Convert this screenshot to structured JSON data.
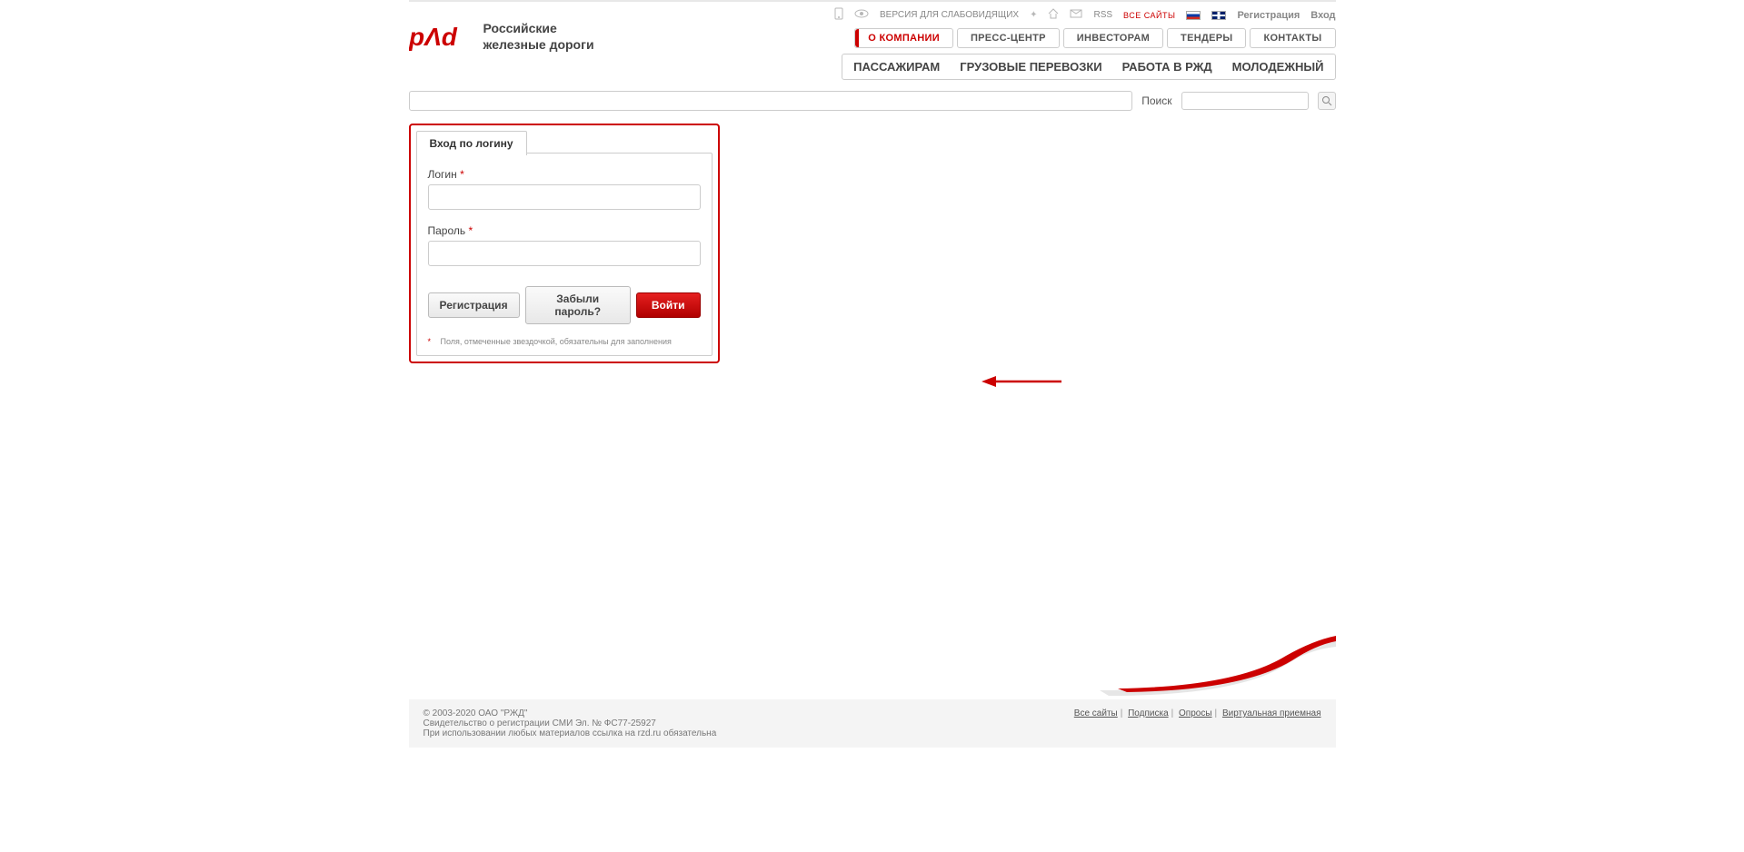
{
  "logo": {
    "line1": "Российские",
    "line2": "железные дороги",
    "mark": "РЖД"
  },
  "top": {
    "visually_impaired": "ВЕРСИЯ ДЛЯ СЛАБОВИДЯЩИХ",
    "rss": "RSS",
    "all_sites": "ВСЕ САЙТЫ",
    "register": "Регистрация",
    "login": "Вход"
  },
  "nav1": [
    {
      "label": "О КОМПАНИИ",
      "active": true
    },
    {
      "label": "ПРЕСС-ЦЕНТР",
      "active": false
    },
    {
      "label": "ИНВЕСТОРАМ",
      "active": false
    },
    {
      "label": "ТЕНДЕРЫ",
      "active": false
    },
    {
      "label": "КОНТАКТЫ",
      "active": false
    }
  ],
  "nav2": [
    "ПАССАЖИРАМ",
    "ГРУЗОВЫЕ ПЕРЕВОЗКИ",
    "РАБОТА В РЖД",
    "МОЛОДЕЖНЫЙ"
  ],
  "search": {
    "label": "Поиск",
    "value": ""
  },
  "login_form": {
    "tab": "Вход по логину",
    "login_label": "Логин",
    "password_label": "Пароль",
    "register_btn": "Регистрация",
    "forgot_btn": "Забыли пароль?",
    "submit_btn": "Войти",
    "required_note": "Поля, отмеченные звездочкой, обязательны для заполнения",
    "required_mark": "*"
  },
  "footer": {
    "copyright": "© 2003-2020 ОАО \"РЖД\"",
    "cert": "Свидетельство о регистрации СМИ Эл. № ФС77-25927",
    "attribution": "При использовании любых материалов ссылка на rzd.ru обязательна",
    "links": [
      "Все сайты",
      "Подписка",
      "Опросы",
      "Виртуальная приемная"
    ]
  }
}
